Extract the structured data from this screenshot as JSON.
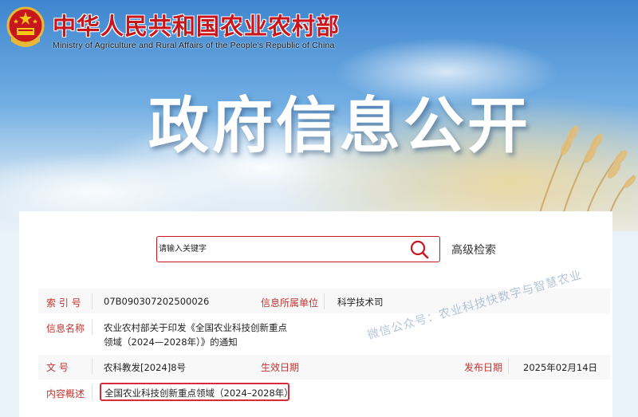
{
  "header": {
    "ministry_cn": "中华人民共和国农业农村部",
    "ministry_en": "Ministry of Agriculture and Rural Affairs of the People's Republic of China"
  },
  "banner": {
    "title": "政府信息公开"
  },
  "search": {
    "placeholder": "请输入关键字",
    "advanced_label": "高级检索"
  },
  "info": {
    "index_label": "索 引 号",
    "index_value": "07B090307202500026",
    "unit_label": "信息所属单位",
    "unit_value": "科学技术司",
    "name_label": "信息名称",
    "name_value": "农业农村部关于印发《全国农业科技创新重点领域（2024—2028年）》的通知",
    "docno_label": "文    号",
    "docno_value": "农科教发[2024]8号",
    "effective_label": "生效日期",
    "effective_value": "",
    "publish_label": "发布日期",
    "publish_value": "2025年02月14日",
    "summary_label": "内容概述",
    "summary_value": "全国农业科技创新重点领域（2024–2028年）"
  },
  "watermark": "微信公众号：农业科技快数字与智慧农业",
  "colors": {
    "brand_red": "#c8161d",
    "label_red": "#c23531",
    "highlight_box": "#d62c3c"
  }
}
